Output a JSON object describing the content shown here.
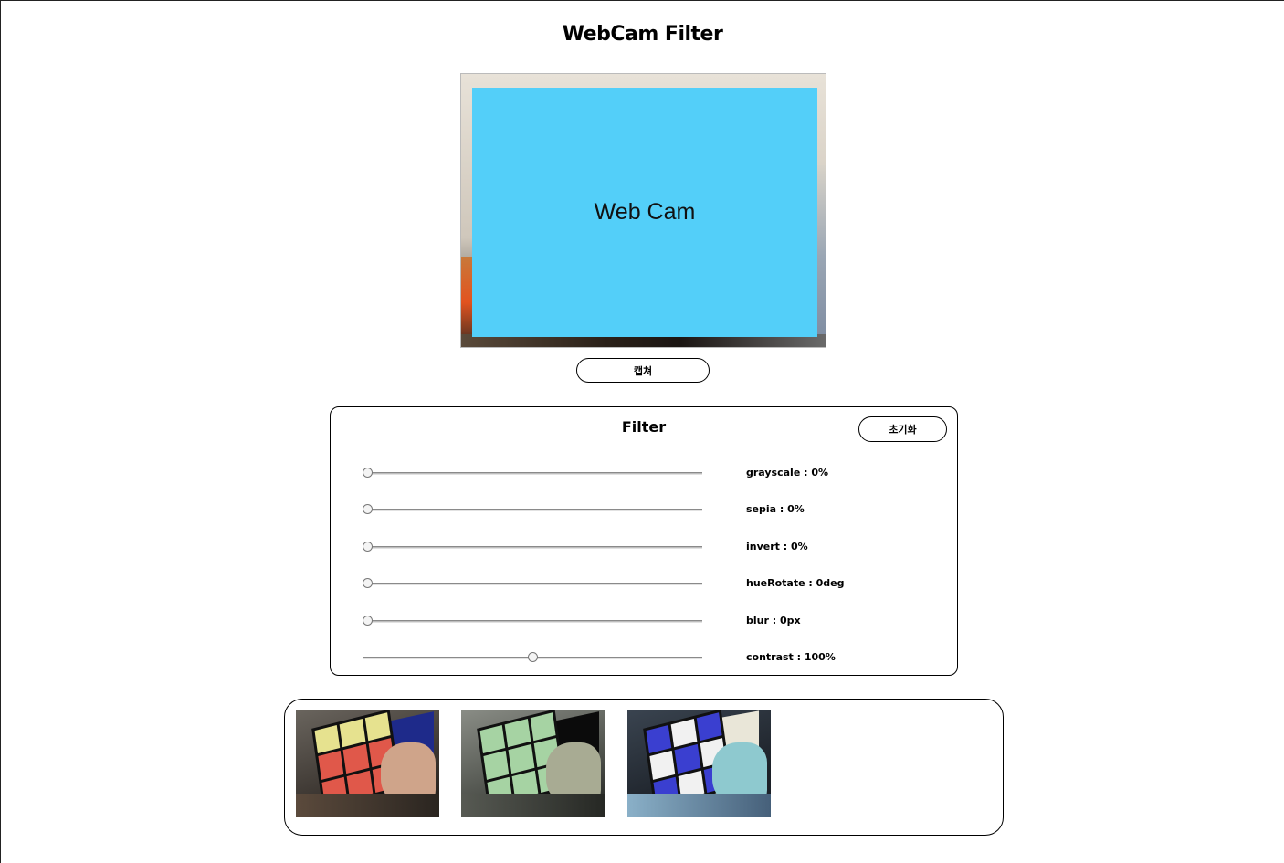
{
  "page": {
    "title": "WebCam Filter"
  },
  "camera": {
    "overlay_text": "Web Cam",
    "overlay_color": "#53cff9"
  },
  "capture_button": {
    "label": "캡쳐"
  },
  "filter": {
    "title": "Filter",
    "reset_label": "초기화",
    "sliders": [
      {
        "key": "grayscale",
        "label": "grayscale : 0%",
        "value": 0,
        "min": 0,
        "max": 100
      },
      {
        "key": "sepia",
        "label": "sepia : 0%",
        "value": 0,
        "min": 0,
        "max": 100
      },
      {
        "key": "invert",
        "label": "invert : 0%",
        "value": 0,
        "min": 0,
        "max": 100
      },
      {
        "key": "hueRotate",
        "label": "hueRotate : 0deg",
        "value": 0,
        "min": 0,
        "max": 360
      },
      {
        "key": "blur",
        "label": "blur : 0px",
        "value": 0,
        "min": 0,
        "max": 10
      },
      {
        "key": "contrast",
        "label": "contrast : 100%",
        "value": 100,
        "min": 0,
        "max": 200
      }
    ]
  },
  "gallery": {
    "captures": [
      {
        "filter": "normal",
        "icon": "rubiks-cube-photo"
      },
      {
        "filter": "tinted-green",
        "icon": "rubiks-cube-photo"
      },
      {
        "filter": "inverted",
        "icon": "rubiks-cube-photo"
      }
    ]
  }
}
